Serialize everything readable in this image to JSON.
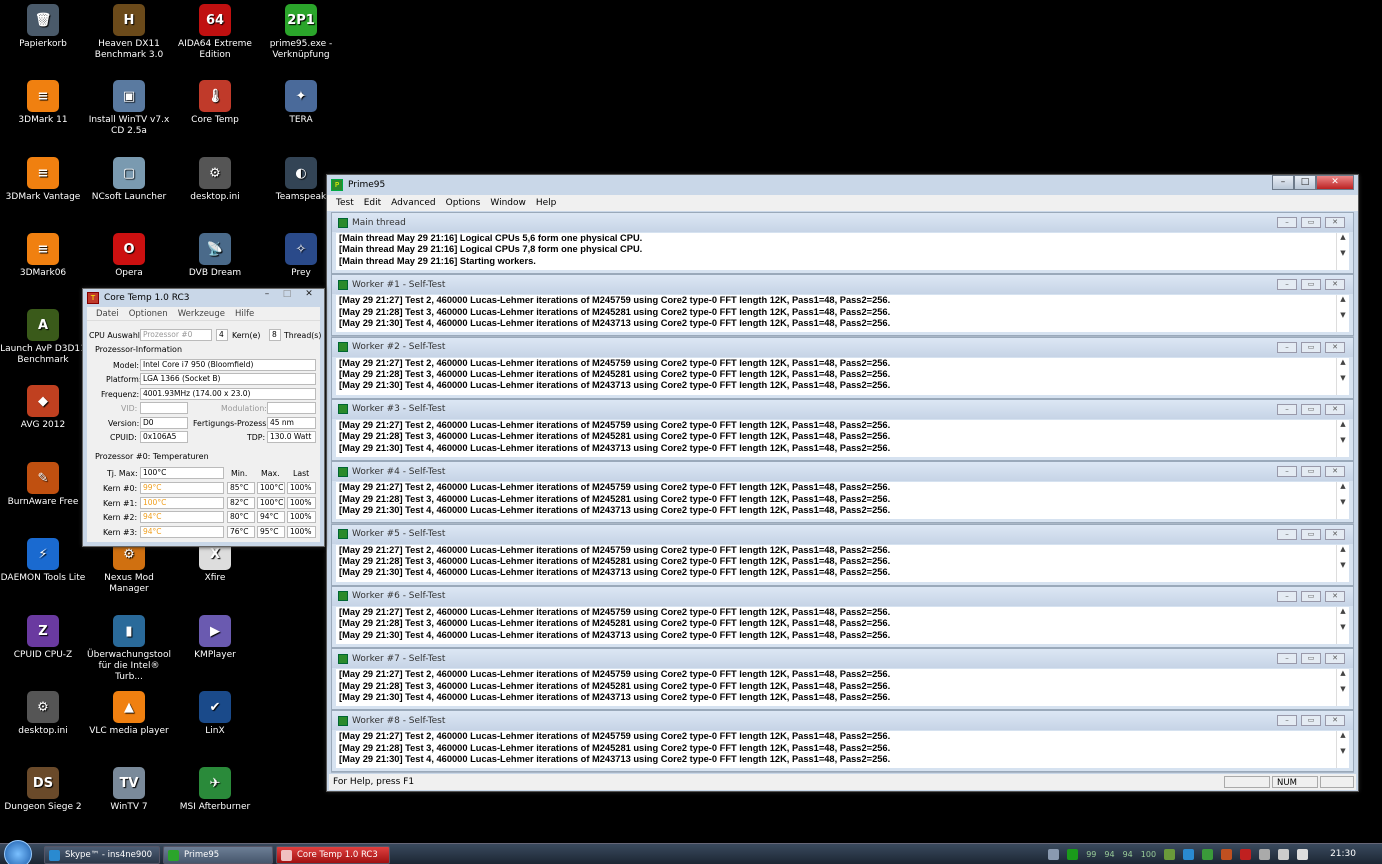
{
  "desktop": {
    "icons": [
      {
        "label": "Papierkorb",
        "glyph": "🗑",
        "color": "#4a5a6a"
      },
      {
        "label": "Heaven DX11 Benchmark 3.0",
        "glyph": "H",
        "color": "#6b4a1a"
      },
      {
        "label": "AIDA64 Extreme Edition",
        "glyph": "64",
        "color": "#c01010"
      },
      {
        "label": "prime95.exe - Verknüpfung",
        "glyph": "2P1",
        "color": "#2ba52b"
      },
      {
        "label": "3DMark 11",
        "glyph": "≡",
        "color": "#f08010"
      },
      {
        "label": "Install WinTV v7.x CD 2.5a",
        "glyph": "▣",
        "color": "#5a7aa0"
      },
      {
        "label": "Core Temp",
        "glyph": "🌡",
        "color": "#c03a2a"
      },
      {
        "label": "TERA",
        "glyph": "✦",
        "color": "#4a6a9a"
      },
      {
        "label": "3DMark Vantage",
        "glyph": "≡",
        "color": "#f08010"
      },
      {
        "label": "NCsoft Launcher",
        "glyph": "▢",
        "color": "#7a9ab0"
      },
      {
        "label": "desktop.ini",
        "glyph": "⚙",
        "color": "#555"
      },
      {
        "label": "Teamspeak",
        "glyph": "◐",
        "color": "#345"
      },
      {
        "label": "3DMark06",
        "glyph": "≡",
        "color": "#f08010"
      },
      {
        "label": "Opera",
        "glyph": "O",
        "color": "#cc1010"
      },
      {
        "label": "DVB Dream",
        "glyph": "📡",
        "color": "#4a6a8a"
      },
      {
        "label": "Prey",
        "glyph": "✧",
        "color": "#2a4a8a"
      },
      {
        "label": "Launch AvP D3D11 Benchmark",
        "glyph": "A",
        "color": "#3a5a1a"
      },
      {
        "label": "AVG 2012",
        "glyph": "◆",
        "color": "#c04020"
      },
      {
        "label": "BurnAware Free",
        "glyph": "✎",
        "color": "#c05010"
      },
      {
        "label": "DAEMON Tools Lite",
        "glyph": "⚡",
        "color": "#1a6ad0"
      },
      {
        "label": "Nexus Mod Manager",
        "glyph": "⚙",
        "color": "#d07010"
      },
      {
        "label": "Xfire",
        "glyph": "X",
        "color": "#ddd"
      },
      {
        "label": "CPUID CPU-Z",
        "glyph": "Z",
        "color": "#6a3aa0"
      },
      {
        "label": "Überwachungstool für die Intel® Turb...",
        "glyph": "▮",
        "color": "#2a6a9a"
      },
      {
        "label": "KMPlayer",
        "glyph": "▶",
        "color": "#6a5ab0"
      },
      {
        "label": "desktop.ini",
        "glyph": "⚙",
        "color": "#555"
      },
      {
        "label": "VLC media player",
        "glyph": "▲",
        "color": "#f08010"
      },
      {
        "label": "LinX",
        "glyph": "✔",
        "color": "#1a4a8a"
      },
      {
        "label": "Dungeon Siege 2",
        "glyph": "DS",
        "color": "#6a4a2a"
      },
      {
        "label": "WinTV 7",
        "glyph": "TV",
        "color": "#7a8a9a"
      },
      {
        "label": "MSI Afterburner",
        "glyph": "✈",
        "color": "#2a8a3a"
      }
    ]
  },
  "prime95": {
    "title": "Prime95",
    "menu": [
      "Test",
      "Edit",
      "Advanced",
      "Options",
      "Window",
      "Help"
    ],
    "status": "For Help, press F1",
    "num": "NUM",
    "children": [
      {
        "title": "Main thread",
        "lines": [
          "[Main thread May 29 21:16] Logical CPUs 5,6 form one physical CPU.",
          "[Main thread May 29 21:16] Logical CPUs 7,8 form one physical CPU.",
          "[Main thread May 29 21:16] Starting workers."
        ]
      },
      {
        "title": "Worker #1 - Self-Test",
        "lines": [
          "[May 29 21:27] Test 2, 460000 Lucas-Lehmer iterations of M245759 using Core2 type-0 FFT length 12K, Pass1=48, Pass2=256.",
          "[May 29 21:28] Test 3, 460000 Lucas-Lehmer iterations of M245281 using Core2 type-0 FFT length 12K, Pass1=48, Pass2=256.",
          "[May 29 21:30] Test 4, 460000 Lucas-Lehmer iterations of M243713 using Core2 type-0 FFT length 12K, Pass1=48, Pass2=256."
        ]
      },
      {
        "title": "Worker #2 - Self-Test",
        "lines": [
          "[May 29 21:27] Test 2, 460000 Lucas-Lehmer iterations of M245759 using Core2 type-0 FFT length 12K, Pass1=48, Pass2=256.",
          "[May 29 21:28] Test 3, 460000 Lucas-Lehmer iterations of M245281 using Core2 type-0 FFT length 12K, Pass1=48, Pass2=256.",
          "[May 29 21:30] Test 4, 460000 Lucas-Lehmer iterations of M243713 using Core2 type-0 FFT length 12K, Pass1=48, Pass2=256."
        ]
      },
      {
        "title": "Worker #3 - Self-Test",
        "lines": [
          "[May 29 21:27] Test 2, 460000 Lucas-Lehmer iterations of M245759 using Core2 type-0 FFT length 12K, Pass1=48, Pass2=256.",
          "[May 29 21:28] Test 3, 460000 Lucas-Lehmer iterations of M245281 using Core2 type-0 FFT length 12K, Pass1=48, Pass2=256.",
          "[May 29 21:30] Test 4, 460000 Lucas-Lehmer iterations of M243713 using Core2 type-0 FFT length 12K, Pass1=48, Pass2=256."
        ]
      },
      {
        "title": "Worker #4 - Self-Test",
        "lines": [
          "[May 29 21:27] Test 2, 460000 Lucas-Lehmer iterations of M245759 using Core2 type-0 FFT length 12K, Pass1=48, Pass2=256.",
          "[May 29 21:28] Test 3, 460000 Lucas-Lehmer iterations of M245281 using Core2 type-0 FFT length 12K, Pass1=48, Pass2=256.",
          "[May 29 21:30] Test 4, 460000 Lucas-Lehmer iterations of M243713 using Core2 type-0 FFT length 12K, Pass1=48, Pass2=256."
        ]
      },
      {
        "title": "Worker #5 - Self-Test",
        "lines": [
          "[May 29 21:27] Test 2, 460000 Lucas-Lehmer iterations of M245759 using Core2 type-0 FFT length 12K, Pass1=48, Pass2=256.",
          "[May 29 21:28] Test 3, 460000 Lucas-Lehmer iterations of M245281 using Core2 type-0 FFT length 12K, Pass1=48, Pass2=256.",
          "[May 29 21:30] Test 4, 460000 Lucas-Lehmer iterations of M243713 using Core2 type-0 FFT length 12K, Pass1=48, Pass2=256."
        ]
      },
      {
        "title": "Worker #6 - Self-Test",
        "lines": [
          "[May 29 21:27] Test 2, 460000 Lucas-Lehmer iterations of M245759 using Core2 type-0 FFT length 12K, Pass1=48, Pass2=256.",
          "[May 29 21:28] Test 3, 460000 Lucas-Lehmer iterations of M245281 using Core2 type-0 FFT length 12K, Pass1=48, Pass2=256.",
          "[May 29 21:30] Test 4, 460000 Lucas-Lehmer iterations of M243713 using Core2 type-0 FFT length 12K, Pass1=48, Pass2=256."
        ]
      },
      {
        "title": "Worker #7 - Self-Test",
        "lines": [
          "[May 29 21:27] Test 2, 460000 Lucas-Lehmer iterations of M245759 using Core2 type-0 FFT length 12K, Pass1=48, Pass2=256.",
          "[May 29 21:28] Test 3, 460000 Lucas-Lehmer iterations of M245281 using Core2 type-0 FFT length 12K, Pass1=48, Pass2=256.",
          "[May 29 21:30] Test 4, 460000 Lucas-Lehmer iterations of M243713 using Core2 type-0 FFT length 12K, Pass1=48, Pass2=256."
        ]
      },
      {
        "title": "Worker #8 - Self-Test",
        "lines": [
          "[May 29 21:27] Test 2, 460000 Lucas-Lehmer iterations of M245759 using Core2 type-0 FFT length 12K, Pass1=48, Pass2=256.",
          "[May 29 21:28] Test 3, 460000 Lucas-Lehmer iterations of M245281 using Core2 type-0 FFT length 12K, Pass1=48, Pass2=256.",
          "[May 29 21:30] Test 4, 460000 Lucas-Lehmer iterations of M243713 using Core2 type-0 FFT length 12K, Pass1=48, Pass2=256."
        ]
      }
    ]
  },
  "coretemp": {
    "title": "Core Temp 1.0 RC3",
    "menu": [
      "Datei",
      "Optionen",
      "Werkzeuge",
      "Hilfe"
    ],
    "cpu_select_label": "CPU Auswahl:",
    "cpu_select_value": "Prozessor #0",
    "cores": "4",
    "cores_label": "Kern(e)",
    "threads": "8",
    "threads_label": "Thread(s)",
    "info_header": "Prozessor-Information",
    "model_label": "Model:",
    "model": "Intel Core i7 950 (Bloomfield)",
    "platform_label": "Platform:",
    "platform": "LGA 1366 (Socket B)",
    "freq_label": "Frequenz:",
    "freq": "4001.93MHz (174.00 x 23.0)",
    "vid_label": "VID:",
    "vid": "",
    "modulation_label": "Modulation:",
    "modulation": "",
    "version_label": "Version:",
    "version": "D0",
    "process_label": "Fertigungs-Prozess:",
    "process": "45 nm",
    "cpuid_label": "CPUID:",
    "cpuid": "0x106A5",
    "tdp_label": "TDP:",
    "tdp": "130.0 Watt",
    "temp_header": "Prozessor #0: Temperaturen",
    "tjmax_label": "Tj. Max:",
    "tjmax": "100°C",
    "col_min": "Min.",
    "col_max": "Max.",
    "col_last": "Last",
    "rows": [
      {
        "label": "Kern #0:",
        "temp": "99°C",
        "min": "85°C",
        "max": "100°C",
        "load": "100%"
      },
      {
        "label": "Kern #1:",
        "temp": "100°C",
        "min": "82°C",
        "max": "100°C",
        "load": "100%"
      },
      {
        "label": "Kern #2:",
        "temp": "94°C",
        "min": "80°C",
        "max": "94°C",
        "load": "100%"
      },
      {
        "label": "Kern #3:",
        "temp": "94°C",
        "min": "76°C",
        "max": "95°C",
        "load": "100%"
      }
    ]
  },
  "taskbar": {
    "buttons": [
      {
        "label": "Skype™ - ins4ne900",
        "color": "#2a8ad0"
      },
      {
        "label": "Prime95",
        "color": "#2ba52b"
      },
      {
        "label": "Core Temp 1.0 RC3",
        "color": "#c03a2a"
      }
    ],
    "tray_numbers": [
      "99",
      "94",
      "94",
      "100"
    ],
    "clock": "21:30"
  }
}
